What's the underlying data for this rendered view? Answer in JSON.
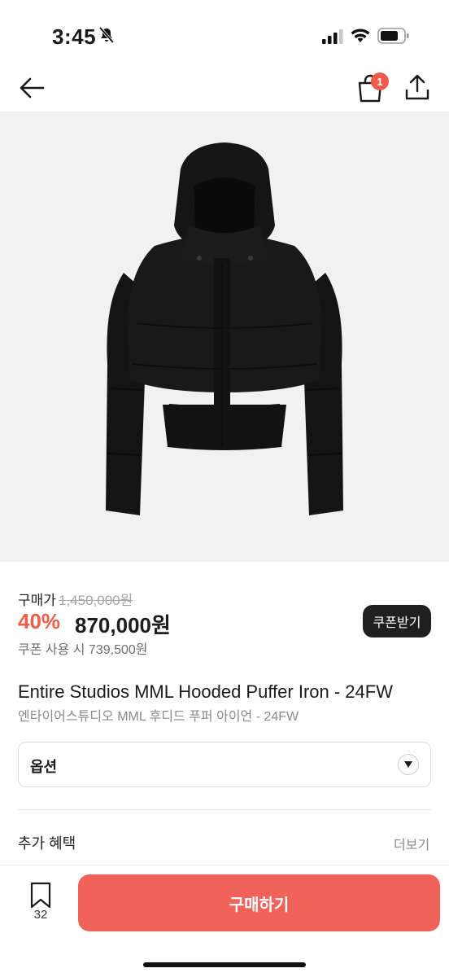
{
  "status_bar": {
    "time": "3:45",
    "icons": [
      "bell-slash-icon",
      "signal-icon",
      "wifi-icon",
      "battery-icon"
    ]
  },
  "nav": {
    "back_icon": "back-arrow-icon",
    "cart_icon": "shopping-bag-icon",
    "cart_badge": "1",
    "share_icon": "share-icon"
  },
  "product": {
    "image": "black cropped hooded puffer jacket",
    "price_label": "구매가",
    "original_price": "1,450,000원",
    "discount": "40%",
    "sale_price": "870,000원",
    "coupon_note": "쿠폰 사용 시 739,500원",
    "coupon_button": "쿠폰받기",
    "title_en": "Entire Studios MML Hooded Puffer Iron - 24FW",
    "title_ko": "엔타이어스튜디오 MML 후디드 푸퍼 아이언 - 24FW"
  },
  "option": {
    "label": "옵션",
    "caret_icon": "chevron-down-icon"
  },
  "benefits": {
    "title": "추가 혜택",
    "more": "더보기"
  },
  "bottom_bar": {
    "wish_count": "32",
    "buy_button": "구매하기"
  },
  "colors": {
    "accent": "#f0625a",
    "discount": "#ef5c48",
    "badge": "#f05a4a",
    "image_bg": "#f1f1f1"
  }
}
